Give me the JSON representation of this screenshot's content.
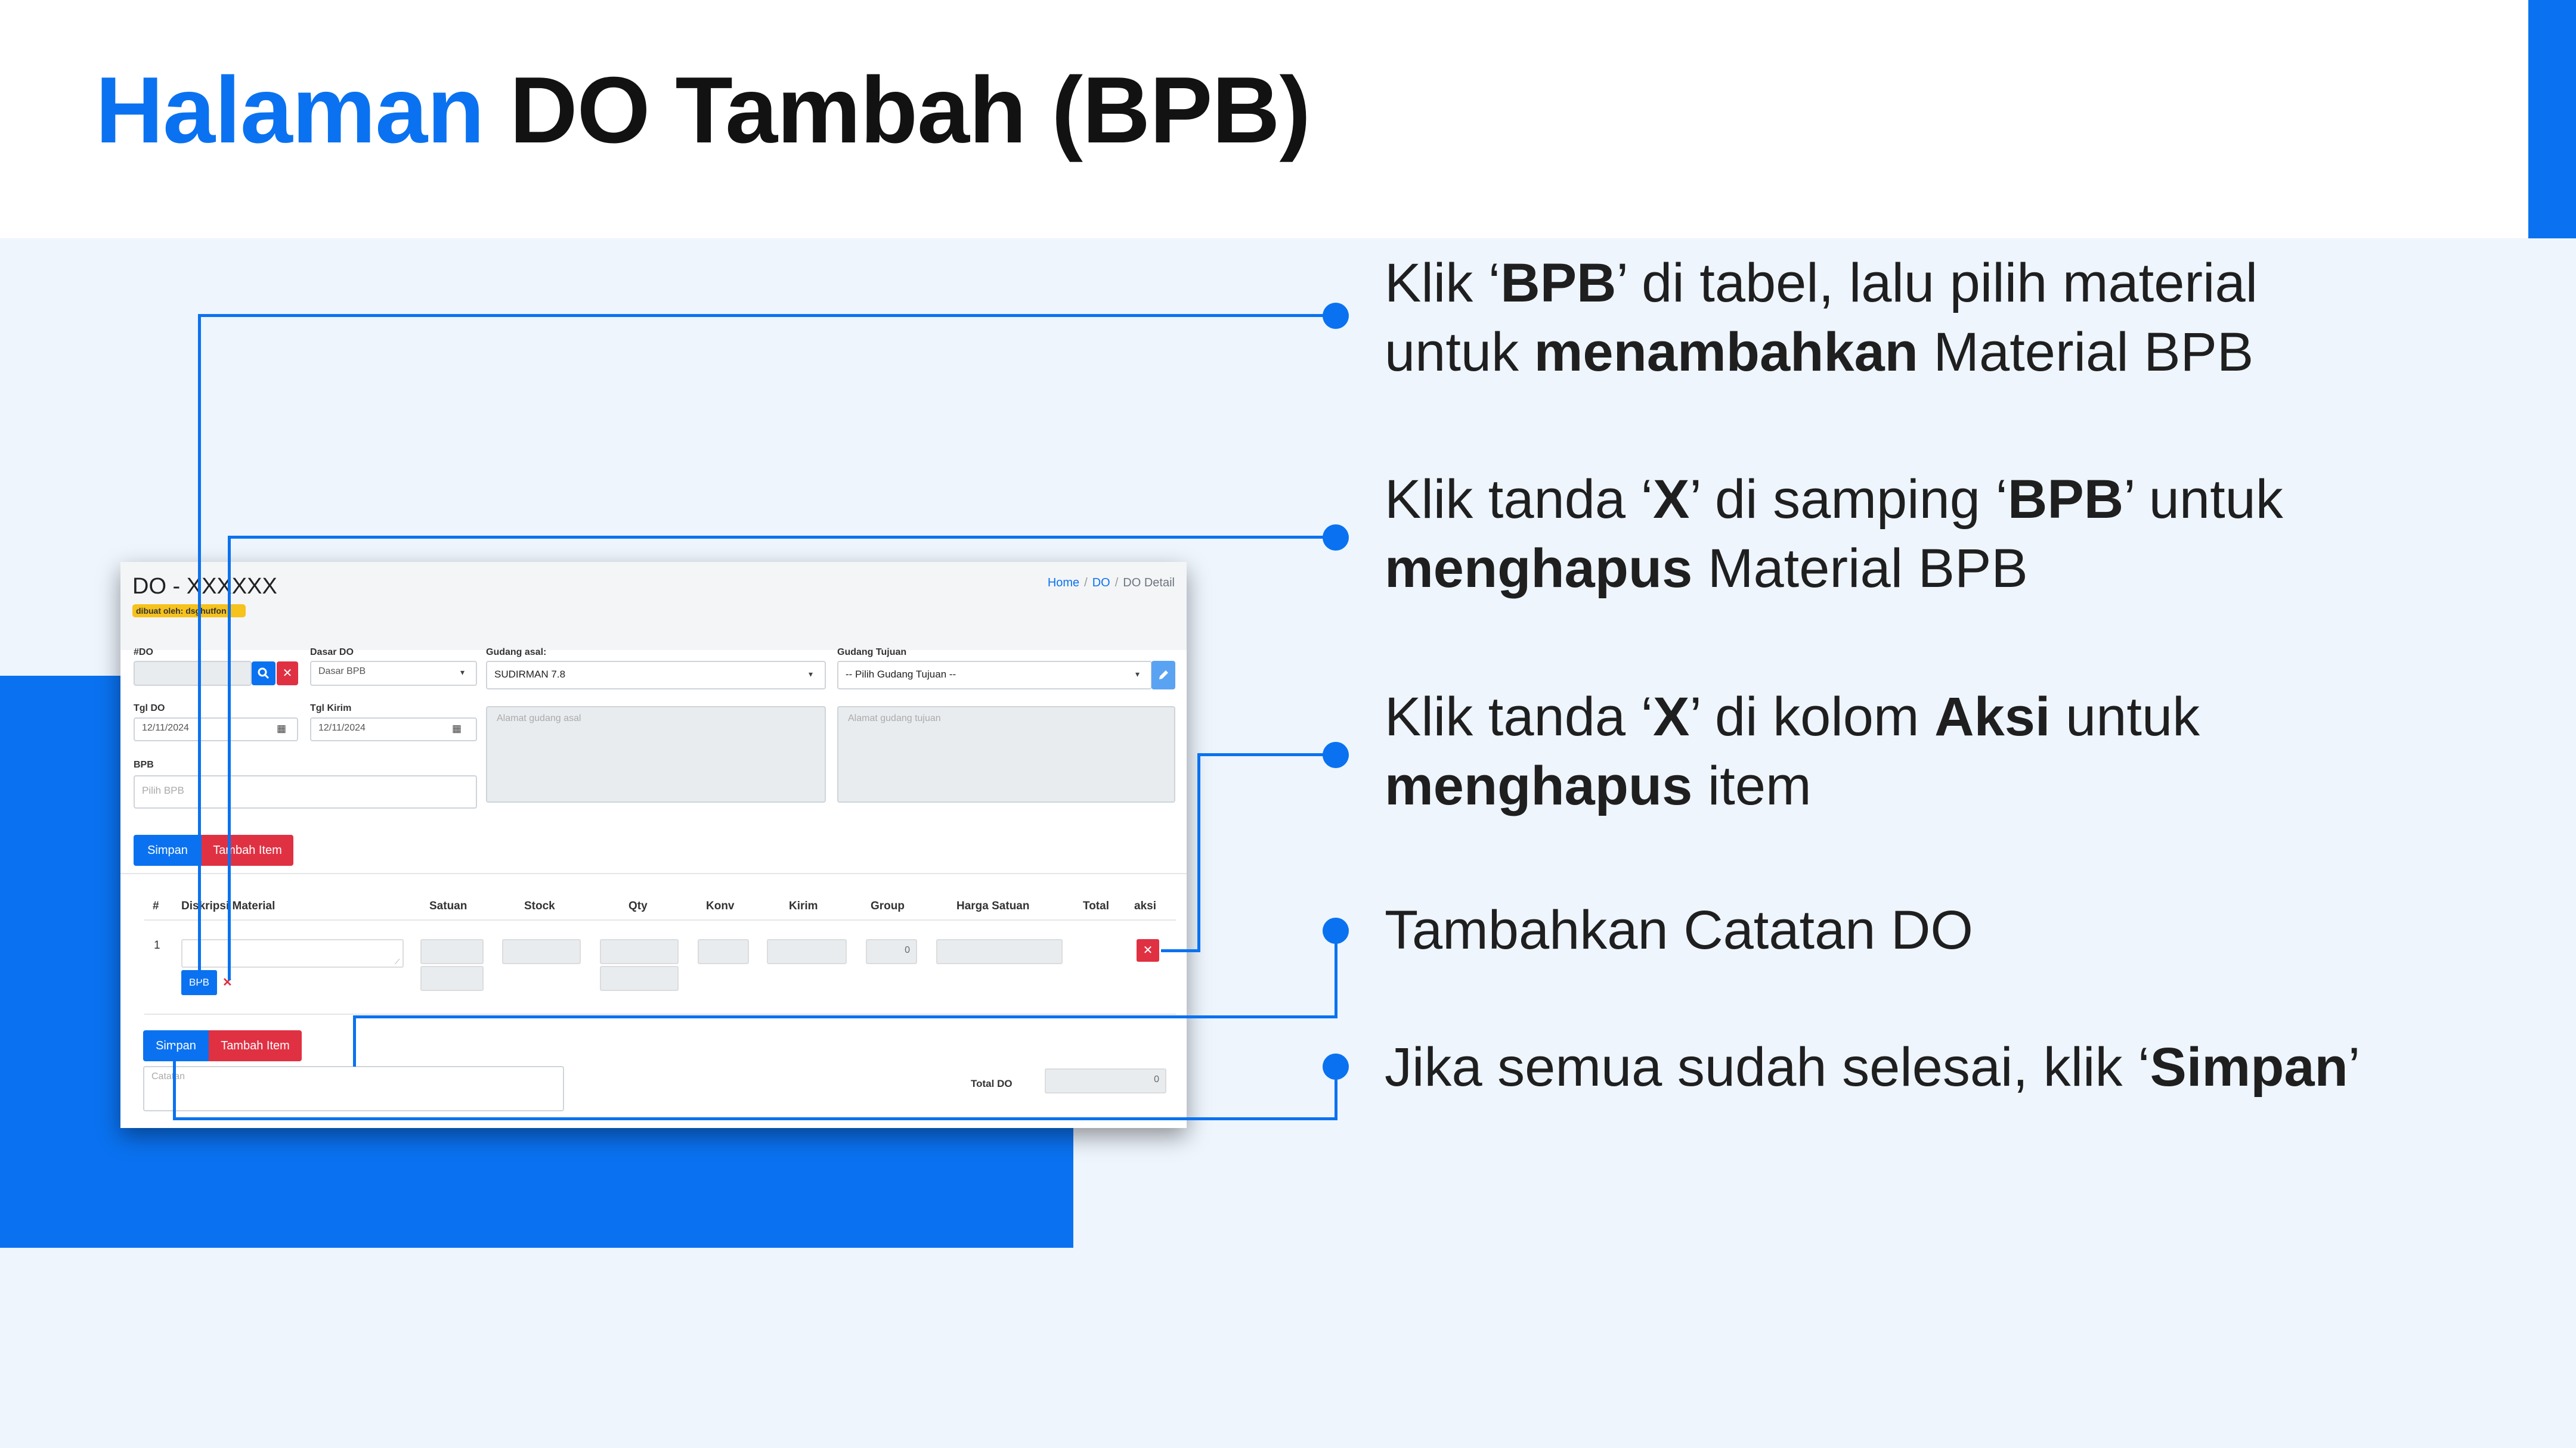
{
  "slide": {
    "title_accent": "Halaman",
    "title_rest": "DO Tambah (BPB)"
  },
  "colors": {
    "accent": "#0a72f0",
    "danger": "#e03143",
    "badge": "#f6c21c",
    "panel_bg": "#eef5fd"
  },
  "app": {
    "do_title": "DO - XXXXXX",
    "created_badge": "dibuat oleh: dsghutfon",
    "breadcrumb": {
      "home": "Home",
      "sep1": "/",
      "do": "DO",
      "sep2": "/",
      "current": "DO Detail"
    },
    "form": {
      "do_no_label": "#DO",
      "do_no_value": "",
      "search_icon": "search-icon",
      "clear_icon": "close-icon",
      "dasar_label": "Dasar DO",
      "dasar_value": "Dasar BPB",
      "gudang_asal_label": "Gudang asal:",
      "gudang_asal_value": "SUDIRMAN 7.8",
      "gudang_tujuan_label": "Gudang Tujuan",
      "gudang_tujuan_value": "-- Pilih Gudang Tujuan --",
      "edit_icon": "pencil-icon",
      "tgl_do_label": "Tgl DO",
      "tgl_do_value": "12/11/2024",
      "tgl_kirim_label": "Tgl Kirim",
      "tgl_kirim_value": "12/11/2024",
      "alamat_asal_placeholder": "Alamat gudang asal",
      "alamat_tujuan_placeholder": "Alamat gudang tujuan",
      "bpb_label": "BPB",
      "bpb_placeholder": "Pilih BPB"
    },
    "buttons": {
      "simpan": "Simpan",
      "tambah_item": "Tambah Item"
    },
    "table": {
      "headers": [
        "#",
        "Diskripsi Material",
        "Satuan",
        "Stock",
        "Qty",
        "Konv",
        "Kirim",
        "Group",
        "Harga Satuan",
        "Total",
        "aksi"
      ],
      "row": {
        "num": "1",
        "group_value": "0",
        "bpb_tag": "BPB",
        "remove_mark": "✕",
        "aksi_mark": "✕"
      }
    },
    "footer": {
      "catatan_placeholder": "Catatan",
      "total_label": "Total DO",
      "total_value": "0"
    }
  },
  "callouts": {
    "c1": {
      "l1_a": "Klik ‘",
      "l1_b": "BPB",
      "l1_c": "’ di tabel, lalu pilih material",
      "l2_a": "untuk ",
      "l2_b": "menambahkan",
      "l2_c": " Material BPB"
    },
    "c2": {
      "l1_a": "Klik tanda ‘",
      "l1_b": "X",
      "l1_c": "’ di samping ‘",
      "l1_d": "BPB",
      "l1_e": "’ untuk",
      "l2_a": "menghapus",
      "l2_b": " Material BPB"
    },
    "c3": {
      "l1_a": "Klik tanda ‘",
      "l1_b": "X",
      "l1_c": "’ di kolom ",
      "l1_d": "Aksi",
      "l1_e": " untuk",
      "l2_a": "menghapus",
      "l2_b": " item"
    },
    "c4": {
      "l1": "Tambahkan Catatan DO"
    },
    "c5": {
      "l1_a": "Jika semua sudah selesai, klik ‘",
      "l1_b": "Simpan",
      "l1_c": "’"
    }
  }
}
